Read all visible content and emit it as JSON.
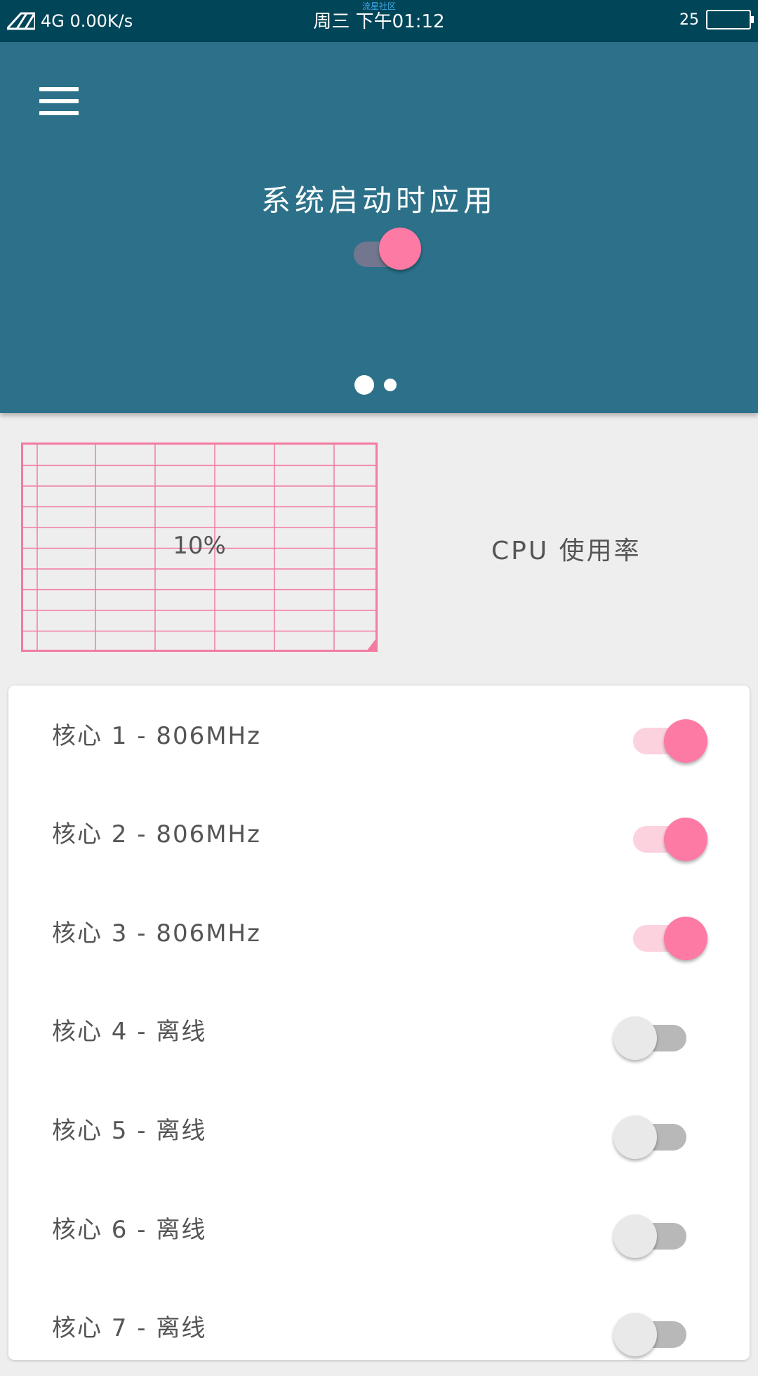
{
  "status_bar": {
    "network": "4G 0.00K/s",
    "datetime": "周三 下午01:12",
    "watermark": "流星社区",
    "battery_level": "25"
  },
  "header": {
    "menu_icon": "hamburger-menu-icon",
    "title": "系统启动时应用",
    "apply_on_boot": true,
    "page_count": 2,
    "active_page": 1,
    "background": "#2c7189"
  },
  "cpu": {
    "usage_text": "10%",
    "label": "CPU 使用率",
    "graph_color": "#f27ca0"
  },
  "cores": [
    {
      "label": "核心 1 - 806MHz",
      "enabled": true
    },
    {
      "label": "核心 2 - 806MHz",
      "enabled": true
    },
    {
      "label": "核心 3 - 806MHz",
      "enabled": true
    },
    {
      "label": "核心 4 - 离线",
      "enabled": false
    },
    {
      "label": "核心 5 - 离线",
      "enabled": false
    },
    {
      "label": "核心 6 - 离线",
      "enabled": false
    },
    {
      "label": "核心 7 - 离线",
      "enabled": false
    }
  ],
  "colors": {
    "accent": "#fd7aa4",
    "status_bar": "#014559"
  }
}
